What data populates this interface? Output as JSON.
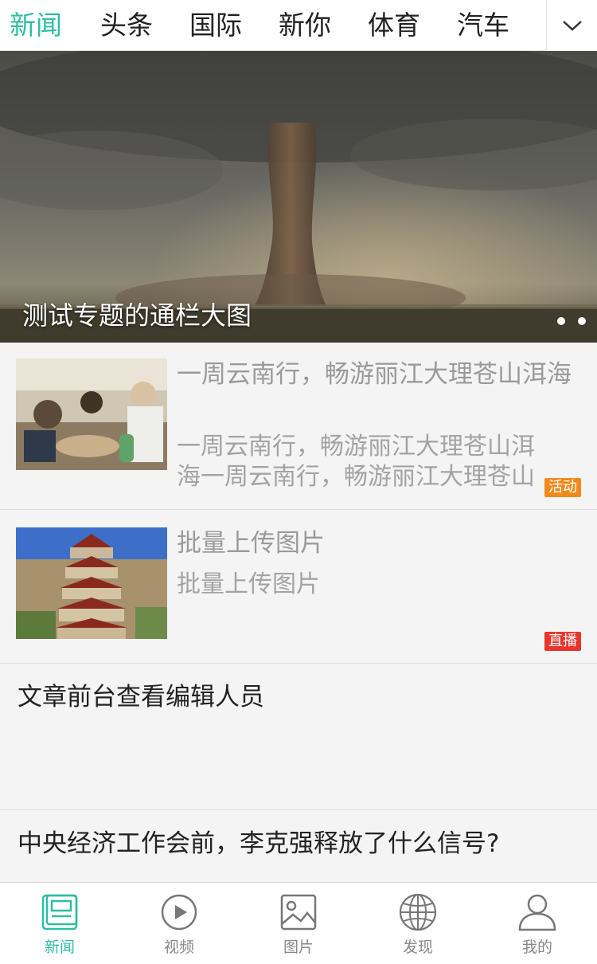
{
  "top_tabs": [
    "新闻",
    "头条",
    "国际",
    "新你",
    "体育",
    "汽车"
  ],
  "active_tab": "新闻",
  "banner": {
    "title": "测试专题的通栏大图",
    "slides": 2
  },
  "news": [
    {
      "title": "一周云南行，畅游丽江大理苍山洱海",
      "desc": "一周云南行，畅游丽江大理苍山洱海一周云南行，畅游丽江大理苍山",
      "badge": "活动",
      "badge_color": "#f08a1c"
    },
    {
      "title": "批量上传图片",
      "desc": "批量上传图片",
      "badge": "直播",
      "badge_color": "#e8352c"
    }
  ],
  "plain_news": [
    {
      "title": "文章前台查看编辑人员"
    },
    {
      "title": "中央经济工作会前，李克强释放了什么信号?"
    }
  ],
  "bottom_nav": [
    {
      "label": "新闻",
      "icon": "news-icon",
      "active": true
    },
    {
      "label": "视频",
      "icon": "video-play-icon",
      "active": false
    },
    {
      "label": "图片",
      "icon": "image-icon",
      "active": false
    },
    {
      "label": "发现",
      "icon": "globe-icon",
      "active": false
    },
    {
      "label": "我的",
      "icon": "user-icon",
      "active": false
    }
  ],
  "colors": {
    "accent": "#2fbda3",
    "text": "#222222",
    "muted": "#9a9a9a"
  }
}
